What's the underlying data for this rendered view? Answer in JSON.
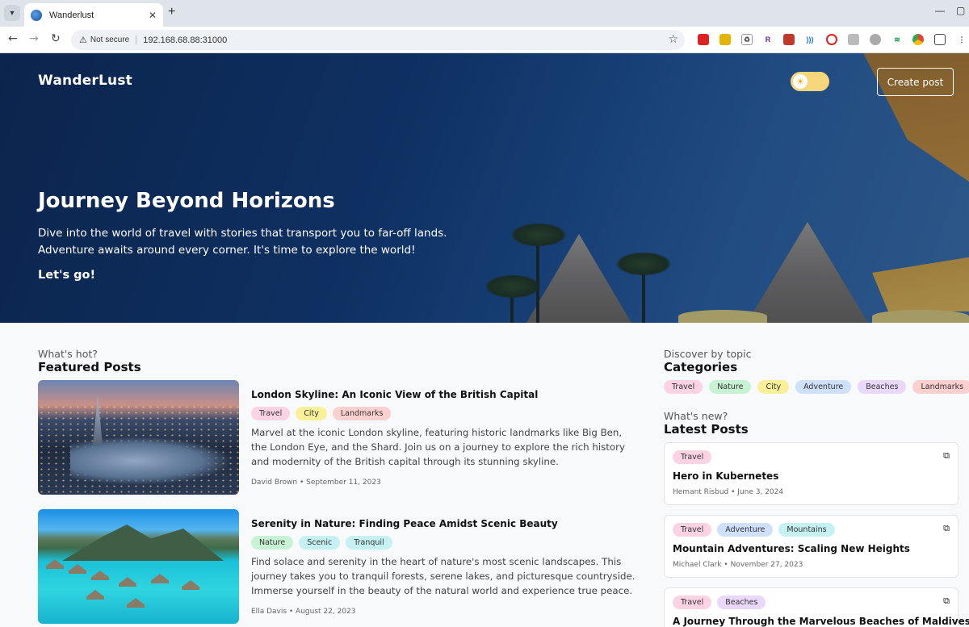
{
  "browser": {
    "tab_title": "Wanderlust",
    "tab_close": "✕",
    "new_tab": "+",
    "not_secure": "Not secure",
    "url": "192.168.68.88:31000"
  },
  "header": {
    "brand": "WanderLust",
    "create_post_label": "Create post"
  },
  "hero": {
    "title": "Journey Beyond Horizons",
    "subtitle": "Dive into the world of travel with stories that transport you to far-off lands. Adventure awaits around every corner. It's time to explore the world!",
    "cta": "Let's go!"
  },
  "featured": {
    "eyebrow": "What's hot?",
    "title": "Featured Posts",
    "posts": [
      {
        "title": "London Skyline: An Iconic View of the British Capital",
        "tags": [
          "Travel",
          "City",
          "Landmarks"
        ],
        "excerpt": "Marvel at the iconic London skyline, featuring historic landmarks like Big Ben, the London Eye, and the Shard. Join us on a journey to explore the rich history and modernity of the British capital through its stunning skyline.",
        "meta": "David Brown • September 11, 2023"
      },
      {
        "title": "Serenity in Nature: Finding Peace Amidst Scenic Beauty",
        "tags": [
          "Nature",
          "Scenic",
          "Tranquil"
        ],
        "excerpt": "Find solace and serenity in the heart of nature's most scenic landscapes. This journey takes you to tranquil forests, serene lakes, and picturesque countryside. Immerse yourself in the beauty of the natural world and experience true peace.",
        "meta": "Ella Davis • August 22, 2023"
      }
    ]
  },
  "categories": {
    "eyebrow": "Discover by topic",
    "title": "Categories",
    "items": [
      "Travel",
      "Nature",
      "City",
      "Adventure",
      "Beaches",
      "Landmarks"
    ]
  },
  "latest": {
    "eyebrow": "What's new?",
    "title": "Latest Posts",
    "posts": [
      {
        "tags": [
          "Travel"
        ],
        "title": "Hero in Kubernetes",
        "meta": "Hemant Risbud • June 3, 2024"
      },
      {
        "tags": [
          "Travel",
          "Adventure",
          "Mountains"
        ],
        "title": "Mountain Adventures: Scaling New Heights",
        "meta": "Michael Clark • November 27, 2023"
      },
      {
        "tags": [
          "Travel",
          "Beaches"
        ],
        "title": "A Journey Through the Marvelous Beaches of Maldives...",
        "meta": ""
      }
    ]
  },
  "tag_colors": {
    "Travel": "#fbd3e3",
    "Nature": "#c8f2d4",
    "City": "#fbf09a",
    "Adventure": "#cfe0fb",
    "Beaches": "#ead8fb",
    "Landmarks": "#fbd0cf",
    "Scenic": "#c5f1f3",
    "Tranquil": "#c5f1f3",
    "Mountains": "#c5f1f3"
  },
  "icons": {
    "tab_list": "chevron-down-icon",
    "back": "arrow-left-icon",
    "forward": "arrow-right-icon",
    "reload": "reload-icon",
    "warning": "warning-icon",
    "bookmark": "star-icon",
    "theme": "sun-icon",
    "external": "external-link-icon"
  }
}
